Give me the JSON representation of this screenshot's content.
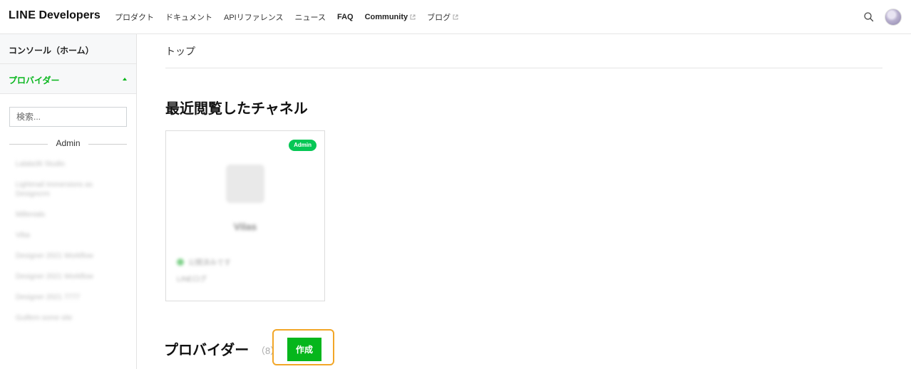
{
  "brand": {
    "line": "LINE",
    "developers": "Developers"
  },
  "nav": [
    {
      "label": "プロダクト",
      "external": false,
      "strong": false
    },
    {
      "label": "ドキュメント",
      "external": false,
      "strong": false
    },
    {
      "label": "APIリファレンス",
      "external": false,
      "strong": false
    },
    {
      "label": "ニュース",
      "external": false,
      "strong": false
    },
    {
      "label": "FAQ",
      "external": false,
      "strong": true
    },
    {
      "label": "Community",
      "external": true,
      "strong": true
    },
    {
      "label": "ブログ",
      "external": true,
      "strong": false
    }
  ],
  "sidebar": {
    "console": "コンソール（ホーム）",
    "providers": "プロバイダー",
    "search_placeholder": "検索...",
    "role_label": "Admin",
    "items": [
      "Lalala36 Studio",
      "Lightmail Immersions as Designcrm",
      "Millenials",
      "Viba",
      "Designer 2021 Workflow",
      "Designer 2021 Workflow",
      "Designer 2021 7777",
      "Guillem some site"
    ]
  },
  "main": {
    "breadcrumb": "トップ",
    "recent_title": "最近閲覧したチャネル",
    "channel_card": {
      "badge": "Admin",
      "name": "Vilas",
      "status": "公開済みです",
      "type": "LINEログ"
    },
    "providers_title": "プロバイダー",
    "providers_count": "（8）",
    "create_label": "作成"
  },
  "colors": {
    "accent_green": "#06b61c",
    "badge_green": "#06c755",
    "highlight_orange": "#f2a627"
  }
}
